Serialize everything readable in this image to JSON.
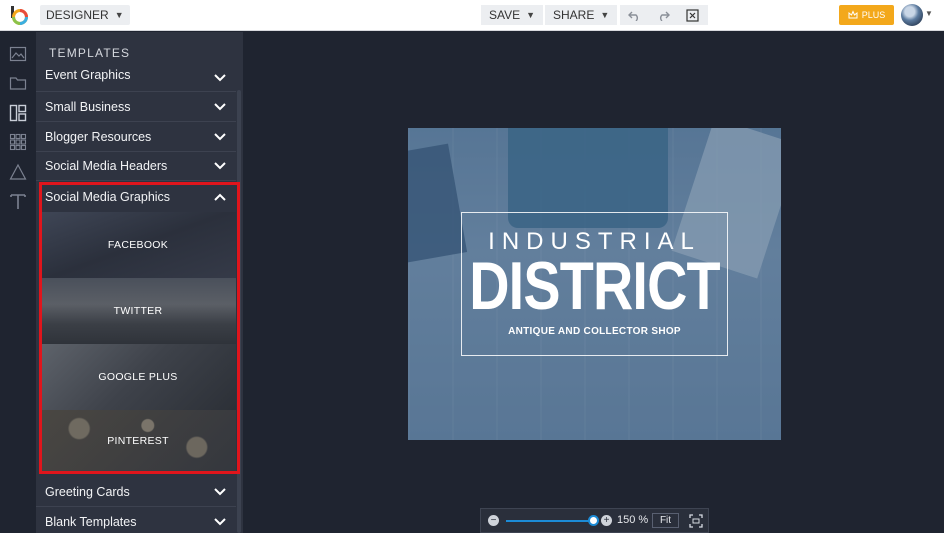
{
  "topbar": {
    "mode_label": "DESIGNER",
    "save_label": "SAVE",
    "share_label": "SHARE",
    "plus_label": "PLUS",
    "plus_color": "#f3a81b"
  },
  "rail": {
    "icons": [
      "image-icon",
      "folder-icon",
      "layout-icon",
      "grid-icon",
      "shape-icon",
      "text-icon"
    ]
  },
  "panel": {
    "title": "TEMPLATES",
    "categories": [
      {
        "label": "Event Graphics"
      },
      {
        "label": "Small Business"
      },
      {
        "label": "Blogger Resources"
      },
      {
        "label": "Social Media Headers"
      },
      {
        "label": "Social Media Graphics",
        "expanded": true
      },
      {
        "label": "Greeting Cards"
      },
      {
        "label": "Blank Templates"
      }
    ],
    "templates": [
      {
        "label": "FACEBOOK"
      },
      {
        "label": "TWITTER"
      },
      {
        "label": "GOOGLE PLUS"
      },
      {
        "label": "PINTEREST"
      }
    ],
    "highlight_color": "#e0151c"
  },
  "canvas": {
    "line1": "INDUSTRIAL",
    "line2": "DISTRICT",
    "line3": "ANTIQUE AND COLLECTOR SHOP"
  },
  "zoom": {
    "percent": "150 %",
    "fit_label": "Fit"
  }
}
